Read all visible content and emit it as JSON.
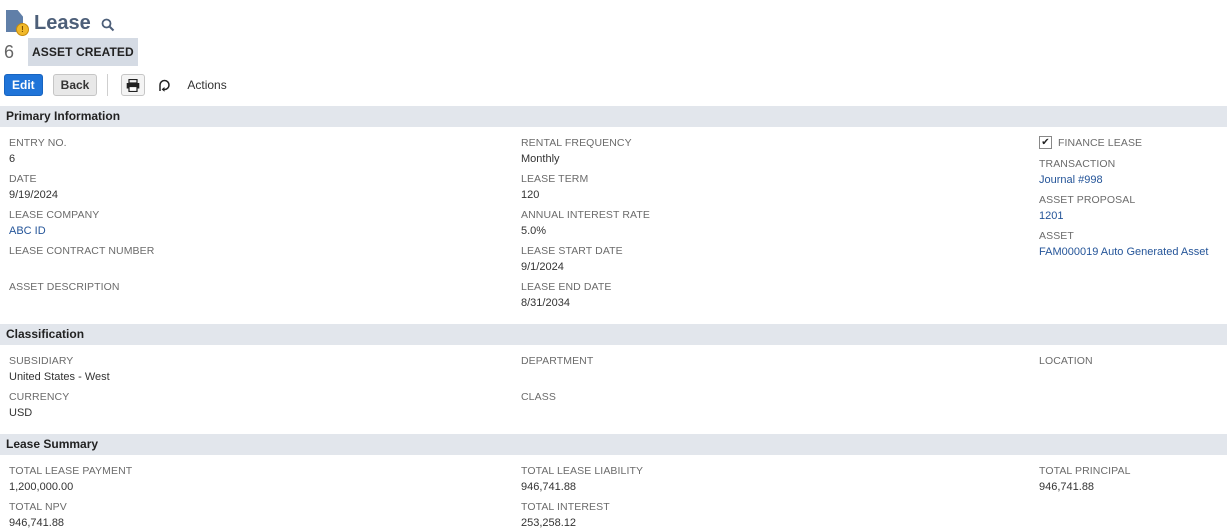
{
  "page": {
    "title": "Lease",
    "record_number": "6",
    "status": "ASSET CREATED"
  },
  "toolbar": {
    "edit_label": "Edit",
    "back_label": "Back",
    "actions_label": "Actions"
  },
  "icons": {
    "record": "lease-record-icon",
    "search": "search-icon",
    "print": "print-icon",
    "actions": "actions-icon",
    "checkbox": "checkmark-icon"
  },
  "colors": {
    "accent": "#1f74d8",
    "link": "#255599",
    "section_header": "#e2e6ec",
    "status_badge": "#d5dbe4",
    "title": "#4d5f79"
  },
  "primary": {
    "section_title": "Primary Information",
    "entry_no": {
      "label": "ENTRY NO.",
      "value": "6"
    },
    "date": {
      "label": "DATE",
      "value": "9/19/2024"
    },
    "lease_company": {
      "label": "LEASE COMPANY",
      "value": "ABC ID"
    },
    "lease_contract_number": {
      "label": "LEASE CONTRACT NUMBER",
      "value": ""
    },
    "asset_description": {
      "label": "ASSET DESCRIPTION",
      "value": ""
    },
    "rental_frequency": {
      "label": "RENTAL FREQUENCY",
      "value": "Monthly"
    },
    "lease_term": {
      "label": "LEASE TERM",
      "value": "120"
    },
    "annual_interest_rate": {
      "label": "ANNUAL INTEREST RATE",
      "value": "5.0%"
    },
    "lease_start_date": {
      "label": "LEASE START DATE",
      "value": "9/1/2024"
    },
    "lease_end_date": {
      "label": "LEASE END DATE",
      "value": "8/31/2034"
    },
    "finance_lease": {
      "label": "FINANCE LEASE",
      "checked": true
    },
    "transaction": {
      "label": "TRANSACTION",
      "value": "Journal #998"
    },
    "asset_proposal": {
      "label": "ASSET PROPOSAL",
      "value": "1201"
    },
    "asset": {
      "label": "ASSET",
      "value": "FAM000019 Auto Generated Asset"
    }
  },
  "classification": {
    "section_title": "Classification",
    "subsidiary": {
      "label": "SUBSIDIARY",
      "value": "United States - West"
    },
    "currency": {
      "label": "CURRENCY",
      "value": "USD"
    },
    "department": {
      "label": "DEPARTMENT",
      "value": ""
    },
    "class": {
      "label": "CLASS",
      "value": ""
    },
    "location": {
      "label": "LOCATION",
      "value": ""
    }
  },
  "summary": {
    "section_title": "Lease Summary",
    "total_lease_payment": {
      "label": "TOTAL LEASE PAYMENT",
      "value": "1,200,000.00"
    },
    "total_npv": {
      "label": "TOTAL NPV",
      "value": "946,741.88"
    },
    "total_lease_liability": {
      "label": "TOTAL LEASE LIABILITY",
      "value": "946,741.88"
    },
    "total_interest": {
      "label": "TOTAL INTEREST",
      "value": "253,258.12"
    },
    "total_principal": {
      "label": "TOTAL PRINCIPAL",
      "value": "946,741.88"
    }
  }
}
